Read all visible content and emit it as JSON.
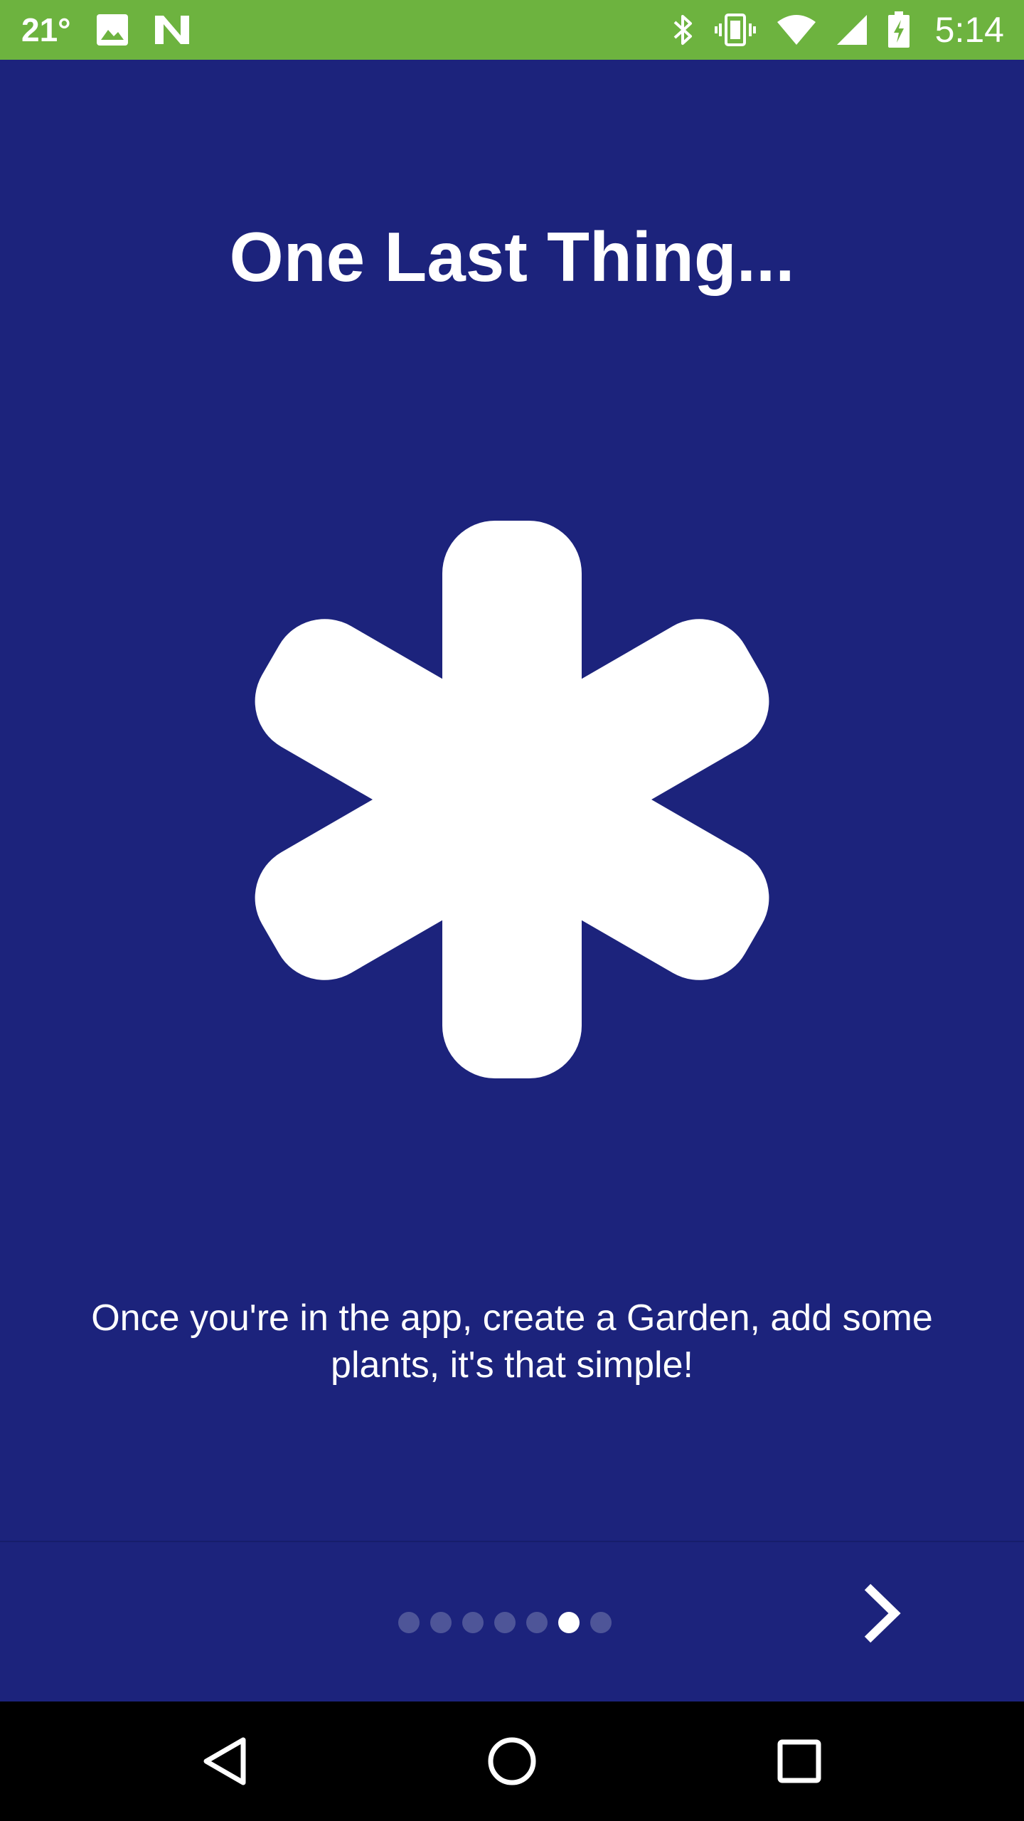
{
  "status_bar": {
    "temperature": "21°",
    "time": "5:14",
    "icons": [
      "image-notification-icon",
      "n-app-notification-icon",
      "bluetooth-icon",
      "vibrate-icon",
      "wifi-icon",
      "cell-signal-icon",
      "battery-charging-icon"
    ],
    "background_color": "#6db33f"
  },
  "onboarding": {
    "title": "One Last Thing...",
    "hero_icon": "asterisk-icon",
    "description": "Once you're in the app, create a Garden, add some plants, it's that simple!",
    "background_color": "#1c237c",
    "page_indicator": {
      "total": 7,
      "current": 6
    },
    "next_icon": "chevron-right-icon"
  },
  "nav_bar": {
    "icons": [
      "back-icon",
      "home-icon",
      "recents-icon"
    ]
  }
}
